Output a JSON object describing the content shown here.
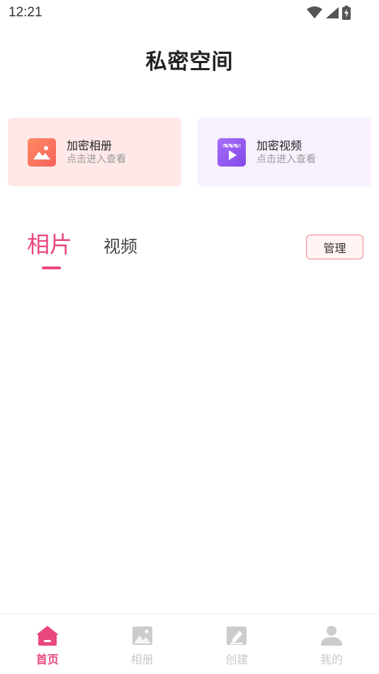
{
  "status_bar": {
    "time": "12:21"
  },
  "header": {
    "title": "私密空间"
  },
  "cards": [
    {
      "title": "加密相册",
      "subtitle": "点击进入查看",
      "icon": "image-icon"
    },
    {
      "title": "加密视频",
      "subtitle": "点击进入查看",
      "icon": "video-icon"
    }
  ],
  "tabs": [
    {
      "label": "相片",
      "active": true
    },
    {
      "label": "视频",
      "active": false
    }
  ],
  "manage_label": "管理",
  "bottom_nav": [
    {
      "label": "首页",
      "icon": "home-icon",
      "active": true
    },
    {
      "label": "相册",
      "icon": "album-icon",
      "active": false
    },
    {
      "label": "创建",
      "icon": "create-icon",
      "active": false
    },
    {
      "label": "我的",
      "icon": "profile-icon",
      "active": false
    }
  ],
  "colors": {
    "accent": "#e8487b",
    "album_card_bg": "#ffe9e8",
    "video_card_bg": "#f8f0fd"
  }
}
